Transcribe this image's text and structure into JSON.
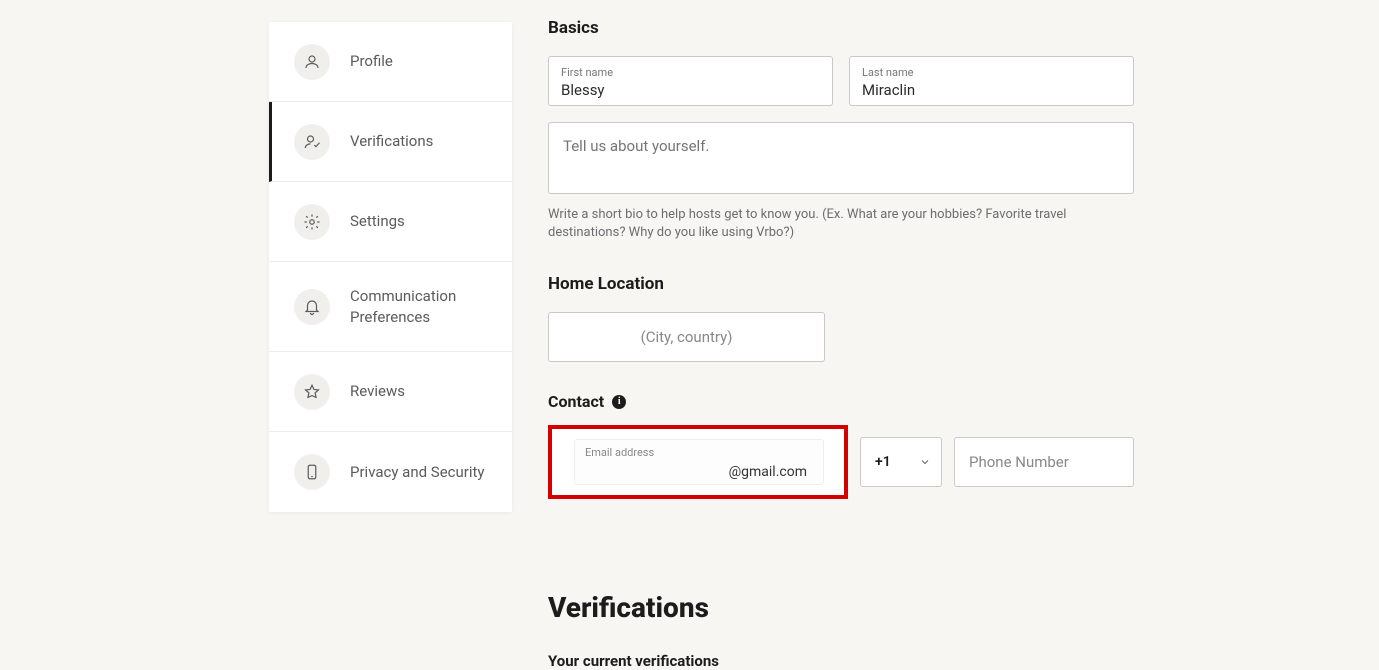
{
  "sidebar": {
    "items": [
      {
        "label": "Profile"
      },
      {
        "label": "Verifications"
      },
      {
        "label": "Settings"
      },
      {
        "label": "Communication Preferences"
      },
      {
        "label": "Reviews"
      },
      {
        "label": "Privacy and Security"
      }
    ]
  },
  "basics": {
    "heading": "Basics",
    "first_name_label": "First name",
    "first_name": "Blessy",
    "last_name_label": "Last name",
    "last_name": "Miraclin",
    "bio_placeholder": "Tell us about yourself.",
    "bio_hint": "Write a short bio to help hosts get to know you. (Ex. What are your hobbies? Favorite travel destinations? Why do you like using Vrbo?)"
  },
  "home": {
    "heading": "Home Location",
    "placeholder": "(City, country)"
  },
  "contact": {
    "heading": "Contact",
    "email_label": "Email address",
    "email_value": "@gmail.com",
    "country_code": "+1",
    "phone_placeholder": "Phone Number"
  },
  "verifications": {
    "heading": "Verifications",
    "subheading": "Your current verifications"
  }
}
